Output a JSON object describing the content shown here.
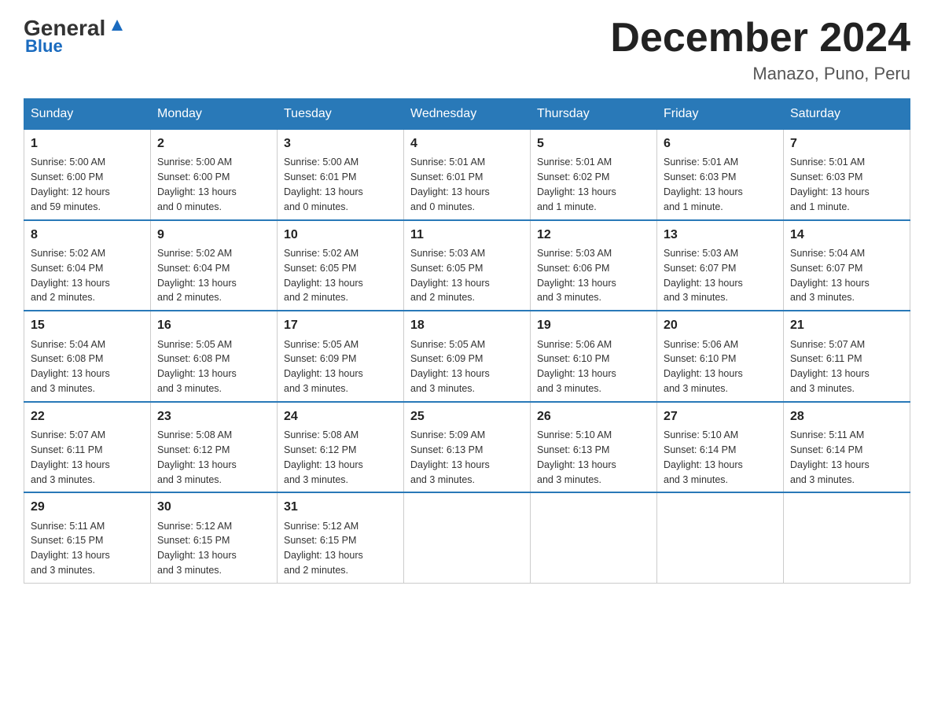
{
  "header": {
    "logo_general": "General",
    "logo_blue": "Blue",
    "month_title": "December 2024",
    "location": "Manazo, Puno, Peru"
  },
  "days_of_week": [
    "Sunday",
    "Monday",
    "Tuesday",
    "Wednesday",
    "Thursday",
    "Friday",
    "Saturday"
  ],
  "weeks": [
    [
      {
        "day": "1",
        "sunrise": "5:00 AM",
        "sunset": "6:00 PM",
        "daylight": "12 hours and 59 minutes."
      },
      {
        "day": "2",
        "sunrise": "5:00 AM",
        "sunset": "6:00 PM",
        "daylight": "13 hours and 0 minutes."
      },
      {
        "day": "3",
        "sunrise": "5:00 AM",
        "sunset": "6:01 PM",
        "daylight": "13 hours and 0 minutes."
      },
      {
        "day": "4",
        "sunrise": "5:01 AM",
        "sunset": "6:01 PM",
        "daylight": "13 hours and 0 minutes."
      },
      {
        "day": "5",
        "sunrise": "5:01 AM",
        "sunset": "6:02 PM",
        "daylight": "13 hours and 1 minute."
      },
      {
        "day": "6",
        "sunrise": "5:01 AM",
        "sunset": "6:03 PM",
        "daylight": "13 hours and 1 minute."
      },
      {
        "day": "7",
        "sunrise": "5:01 AM",
        "sunset": "6:03 PM",
        "daylight": "13 hours and 1 minute."
      }
    ],
    [
      {
        "day": "8",
        "sunrise": "5:02 AM",
        "sunset": "6:04 PM",
        "daylight": "13 hours and 2 minutes."
      },
      {
        "day": "9",
        "sunrise": "5:02 AM",
        "sunset": "6:04 PM",
        "daylight": "13 hours and 2 minutes."
      },
      {
        "day": "10",
        "sunrise": "5:02 AM",
        "sunset": "6:05 PM",
        "daylight": "13 hours and 2 minutes."
      },
      {
        "day": "11",
        "sunrise": "5:03 AM",
        "sunset": "6:05 PM",
        "daylight": "13 hours and 2 minutes."
      },
      {
        "day": "12",
        "sunrise": "5:03 AM",
        "sunset": "6:06 PM",
        "daylight": "13 hours and 3 minutes."
      },
      {
        "day": "13",
        "sunrise": "5:03 AM",
        "sunset": "6:07 PM",
        "daylight": "13 hours and 3 minutes."
      },
      {
        "day": "14",
        "sunrise": "5:04 AM",
        "sunset": "6:07 PM",
        "daylight": "13 hours and 3 minutes."
      }
    ],
    [
      {
        "day": "15",
        "sunrise": "5:04 AM",
        "sunset": "6:08 PM",
        "daylight": "13 hours and 3 minutes."
      },
      {
        "day": "16",
        "sunrise": "5:05 AM",
        "sunset": "6:08 PM",
        "daylight": "13 hours and 3 minutes."
      },
      {
        "day": "17",
        "sunrise": "5:05 AM",
        "sunset": "6:09 PM",
        "daylight": "13 hours and 3 minutes."
      },
      {
        "day": "18",
        "sunrise": "5:05 AM",
        "sunset": "6:09 PM",
        "daylight": "13 hours and 3 minutes."
      },
      {
        "day": "19",
        "sunrise": "5:06 AM",
        "sunset": "6:10 PM",
        "daylight": "13 hours and 3 minutes."
      },
      {
        "day": "20",
        "sunrise": "5:06 AM",
        "sunset": "6:10 PM",
        "daylight": "13 hours and 3 minutes."
      },
      {
        "day": "21",
        "sunrise": "5:07 AM",
        "sunset": "6:11 PM",
        "daylight": "13 hours and 3 minutes."
      }
    ],
    [
      {
        "day": "22",
        "sunrise": "5:07 AM",
        "sunset": "6:11 PM",
        "daylight": "13 hours and 3 minutes."
      },
      {
        "day": "23",
        "sunrise": "5:08 AM",
        "sunset": "6:12 PM",
        "daylight": "13 hours and 3 minutes."
      },
      {
        "day": "24",
        "sunrise": "5:08 AM",
        "sunset": "6:12 PM",
        "daylight": "13 hours and 3 minutes."
      },
      {
        "day": "25",
        "sunrise": "5:09 AM",
        "sunset": "6:13 PM",
        "daylight": "13 hours and 3 minutes."
      },
      {
        "day": "26",
        "sunrise": "5:10 AM",
        "sunset": "6:13 PM",
        "daylight": "13 hours and 3 minutes."
      },
      {
        "day": "27",
        "sunrise": "5:10 AM",
        "sunset": "6:14 PM",
        "daylight": "13 hours and 3 minutes."
      },
      {
        "day": "28",
        "sunrise": "5:11 AM",
        "sunset": "6:14 PM",
        "daylight": "13 hours and 3 minutes."
      }
    ],
    [
      {
        "day": "29",
        "sunrise": "5:11 AM",
        "sunset": "6:15 PM",
        "daylight": "13 hours and 3 minutes."
      },
      {
        "day": "30",
        "sunrise": "5:12 AM",
        "sunset": "6:15 PM",
        "daylight": "13 hours and 3 minutes."
      },
      {
        "day": "31",
        "sunrise": "5:12 AM",
        "sunset": "6:15 PM",
        "daylight": "13 hours and 2 minutes."
      },
      null,
      null,
      null,
      null
    ]
  ],
  "labels": {
    "sunrise": "Sunrise:",
    "sunset": "Sunset:",
    "daylight": "Daylight:"
  }
}
